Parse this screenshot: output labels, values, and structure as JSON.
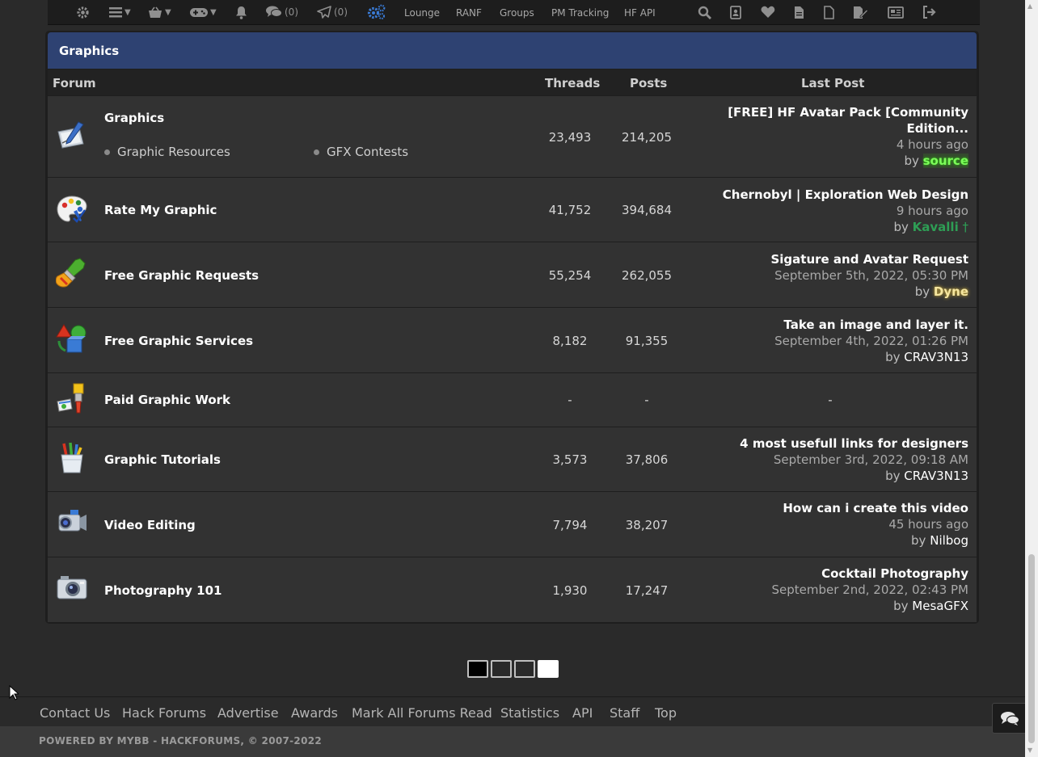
{
  "nav": {
    "pm_count": "(0)",
    "convo_count": "(0)",
    "links": [
      "Lounge",
      "RANF",
      "Groups",
      "PM Tracking",
      "HF API"
    ]
  },
  "category": {
    "title": "Graphics"
  },
  "columns": {
    "forum": "Forum",
    "threads": "Threads",
    "posts": "Posts",
    "last_post": "Last Post"
  },
  "forums": [
    {
      "name": "Graphics",
      "icon": "pen-tablet-icon",
      "subforums": [
        "Graphic Resources",
        "GFX Contests"
      ],
      "threads": "23,493",
      "posts": "214,205",
      "last_title": "[FREE] HF Avatar Pack [Community Edition...",
      "last_date": "4 hours ago",
      "by": "by",
      "last_user": "source",
      "user_color": "#7CFC5A"
    },
    {
      "name": "Rate My Graphic",
      "icon": "palette-icon",
      "threads": "41,752",
      "posts": "394,684",
      "last_title": "Chernobyl | Exploration Web Design",
      "last_date": "9 hours ago",
      "by": "by",
      "last_user": "Kavalli",
      "user_suffix": "†",
      "user_color": "#2e9e55"
    },
    {
      "name": "Free Graphic Requests",
      "icon": "paintbrush-icon",
      "threads": "55,254",
      "posts": "262,055",
      "last_title": "Sigature and Avatar Request",
      "last_date": "September 5th, 2022, 05:30 PM",
      "by": "by",
      "last_user": "Dyne",
      "user_color": "#f5e6a0"
    },
    {
      "name": "Free Graphic Services",
      "icon": "shapes-icon",
      "threads": "8,182",
      "posts": "91,355",
      "last_title": "Take an image and layer it.",
      "last_date": "September 4th, 2022, 01:26 PM",
      "by": "by",
      "last_user": "CRAV3N13",
      "user_color": "#ffffff"
    },
    {
      "name": "Paid Graphic Work",
      "icon": "paint-money-icon",
      "threads": "-",
      "posts": "-",
      "last_dash": "-"
    },
    {
      "name": "Graphic Tutorials",
      "icon": "pencil-cup-icon",
      "threads": "3,573",
      "posts": "37,806",
      "last_title": "4 most usefull links for designers",
      "last_date": "September 3rd, 2022, 09:18 AM",
      "by": "by",
      "last_user": "CRAV3N13",
      "user_color": "#ffffff"
    },
    {
      "name": "Video Editing",
      "icon": "video-camera-icon",
      "threads": "7,794",
      "posts": "38,207",
      "last_title": "How can i create this video",
      "last_date": "45 hours ago",
      "by": "by",
      "last_user": "Nilbog",
      "user_color": "#ffffff"
    },
    {
      "name": "Photography 101",
      "icon": "camera-icon",
      "threads": "1,930",
      "posts": "17,247",
      "last_title": "Cocktail Photography",
      "last_date": "September 2nd, 2022, 02:43 PM",
      "by": "by",
      "last_user": "MesaGFX",
      "user_color": "#ffffff"
    }
  ],
  "theme_selector": {
    "options": [
      "black",
      "dark",
      "gray",
      "white"
    ],
    "colors": [
      "#000000",
      "#2a2a2a",
      "#2a2a2a",
      "#ffffff"
    ]
  },
  "footer": {
    "links": [
      "Contact Us",
      "Hack Forums",
      "Advertise",
      "Awards",
      "Mark All Forums Read",
      "Statistics",
      "API",
      "Staff",
      "Top"
    ],
    "powered": "POWERED BY MYBB - HACKFORUMS, © 2007-2022"
  },
  "colors": {
    "category_header": "#2e4272",
    "row_bg": "#323232",
    "accent_blue": "#3a7bd5"
  }
}
